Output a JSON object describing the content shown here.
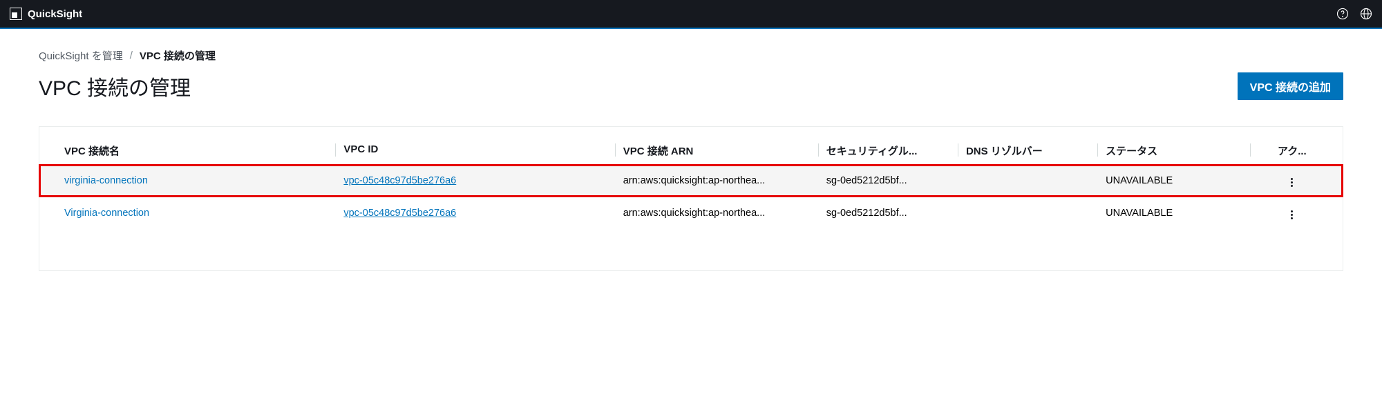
{
  "brand": "QuickSight",
  "breadcrumb": {
    "parent": "QuickSight を管理",
    "current": "VPC 接続の管理"
  },
  "page_title": "VPC 接続の管理",
  "primary_action": "VPC 接続の追加",
  "table": {
    "headers": {
      "name": "VPC 接続名",
      "vpc_id": "VPC ID",
      "arn": "VPC 接続 ARN",
      "sg": "セキュリティグル...",
      "dns": "DNS リゾルバー",
      "status": "ステータス",
      "actions": "アク..."
    },
    "rows": [
      {
        "name": "virginia-connection",
        "vpc_id": "vpc-05c48c97d5be276a6",
        "arn": "arn:aws:quicksight:ap-northea...",
        "sg": "sg-0ed5212d5bf...",
        "dns": "",
        "status": "UNAVAILABLE"
      },
      {
        "name": "Virginia-connection",
        "vpc_id": "vpc-05c48c97d5be276a6",
        "arn": "arn:aws:quicksight:ap-northea...",
        "sg": "sg-0ed5212d5bf...",
        "dns": "",
        "status": "UNAVAILABLE"
      }
    ]
  }
}
